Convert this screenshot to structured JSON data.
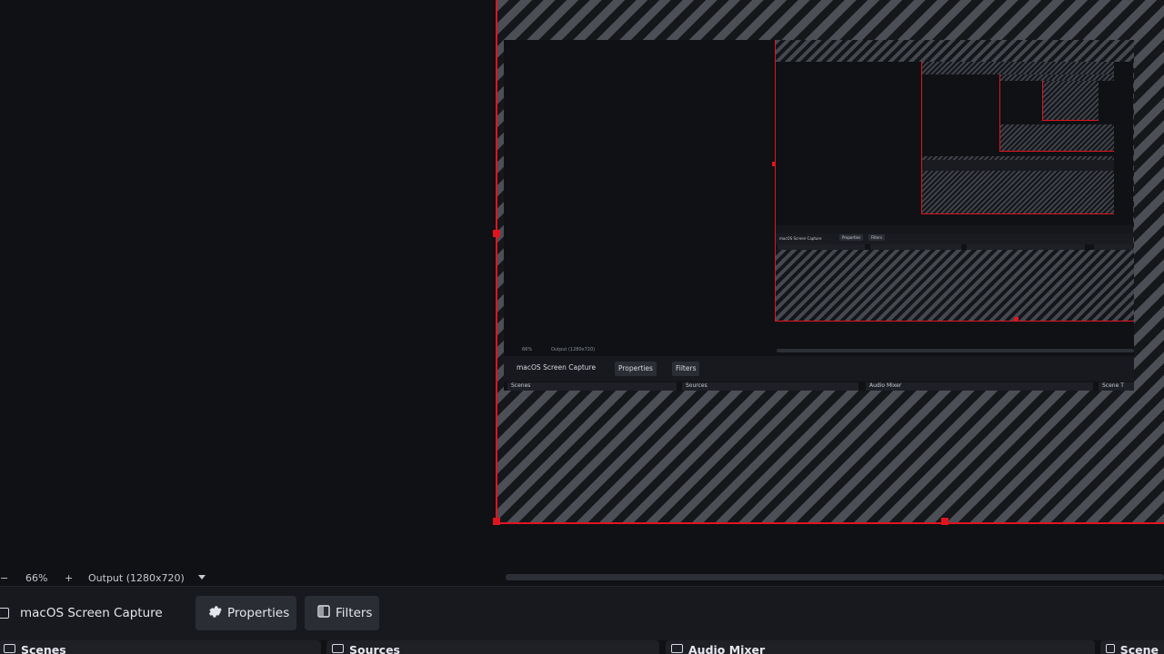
{
  "preview_toolbar": {
    "zoom_out": "−",
    "zoom_level": "66%",
    "zoom_in": "+",
    "output_label": "Output (1280x720)",
    "dropdown_icon": "chevron-down-icon"
  },
  "context_bar": {
    "source_name": "macOS Screen Capture",
    "properties_label": "Properties",
    "filters_label": "Filters"
  },
  "docks": {
    "scenes": "Scenes",
    "sources": "Sources",
    "audio_mixer": "Audio Mixer",
    "scene_transitions": "Scene"
  },
  "nested_level2": {
    "zoom_level": "66%",
    "output_label": "Output (1280x720)",
    "source_name": "macOS Screen Capture",
    "properties_label": "Properties",
    "filters_label": "Filters",
    "scenes": "Scenes",
    "sources": "Sources",
    "audio_mixer": "Audio Mixer",
    "scene_transitions": "Scene T"
  },
  "colors": {
    "selection": "#e0141e",
    "background": "#0f1115",
    "panel": "#17191e",
    "button": "#2a2d34"
  }
}
